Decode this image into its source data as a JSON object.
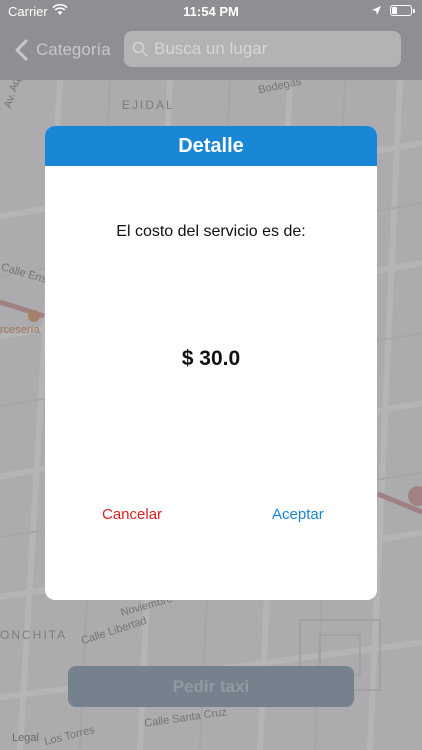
{
  "status_bar": {
    "carrier": "Carrier",
    "time": "11:54 PM"
  },
  "nav": {
    "back_label": "Categoría",
    "search_placeholder": "Busca un lugar"
  },
  "map": {
    "labels": {
      "ejidal": "EJIDAL",
      "av_aqui": "Av. Aqu",
      "bodegas": "Bodegas",
      "calle_ensenada": "Calle Enseña",
      "cerveceria": "rcesería",
      "noviembre": "Noviembre",
      "calle_libertad": "Calle Libertad",
      "conchita": "ONCHITA",
      "calle_santa_cruz": "Calle Santa Cruz",
      "los_torres": "Los Torres",
      "legal": "Legal"
    }
  },
  "dialog": {
    "title": "Detalle",
    "message": "El costo del servicio es de:",
    "amount": "$ 30.0",
    "cancel_label": "Cancelar",
    "accept_label": "Aceptar"
  },
  "bottom": {
    "request_label": "Pedir taxi"
  },
  "colors": {
    "header_blue": "#1a86d6",
    "cancel_red": "#e02020",
    "nav_gray": "#8f8f93",
    "button_disabled": "#8aa0b2"
  }
}
